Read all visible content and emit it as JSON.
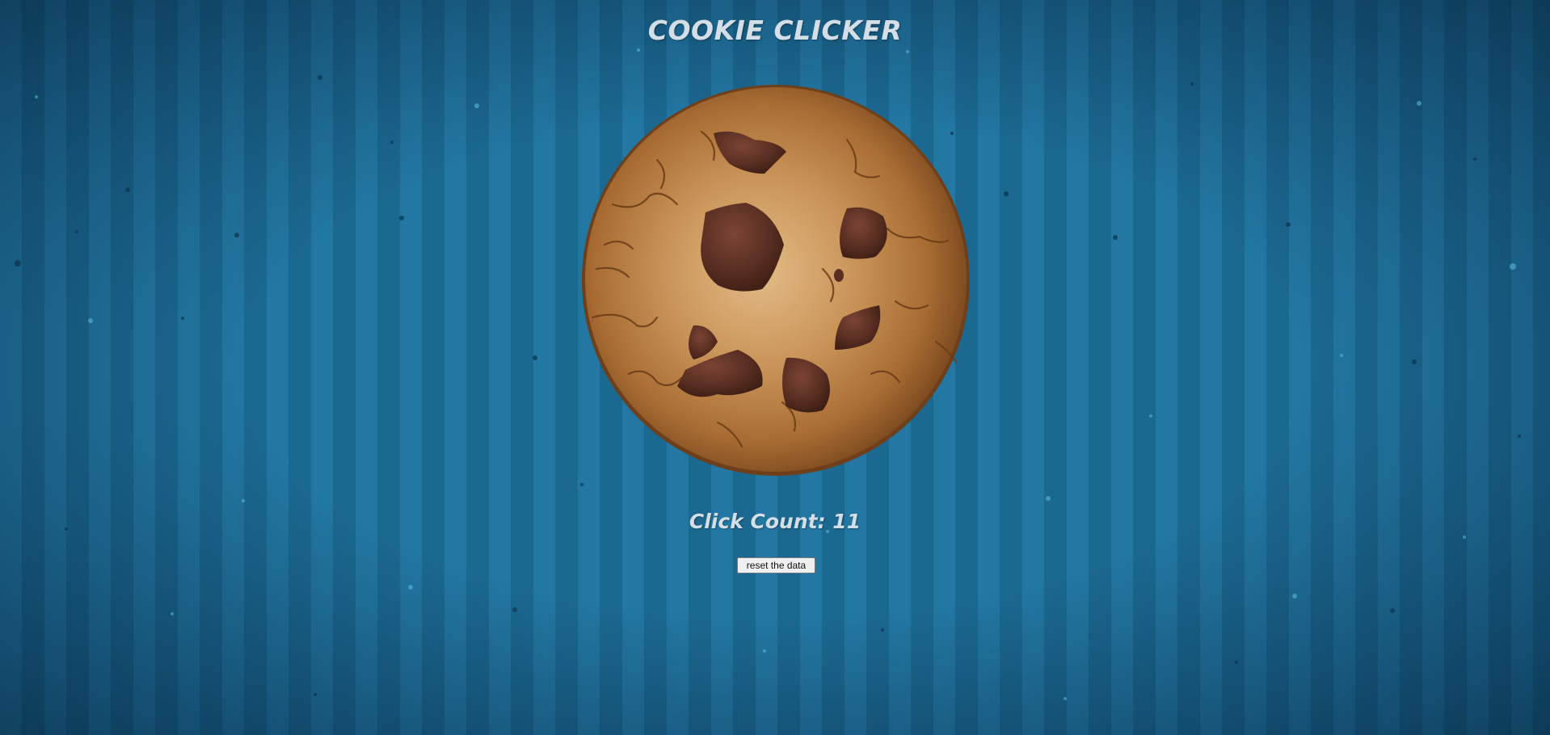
{
  "page": {
    "title": "COOKIE CLICKER",
    "background_color": "#1f6d96",
    "text_color": "#d3dee6"
  },
  "cookie": {
    "icon": "chocolate-chip-cookie-icon",
    "color": "#b27b43",
    "chip_color": "#5a2f22"
  },
  "counter": {
    "label": "Click Count: 11",
    "value": 11
  },
  "reset": {
    "label": "reset the data"
  }
}
